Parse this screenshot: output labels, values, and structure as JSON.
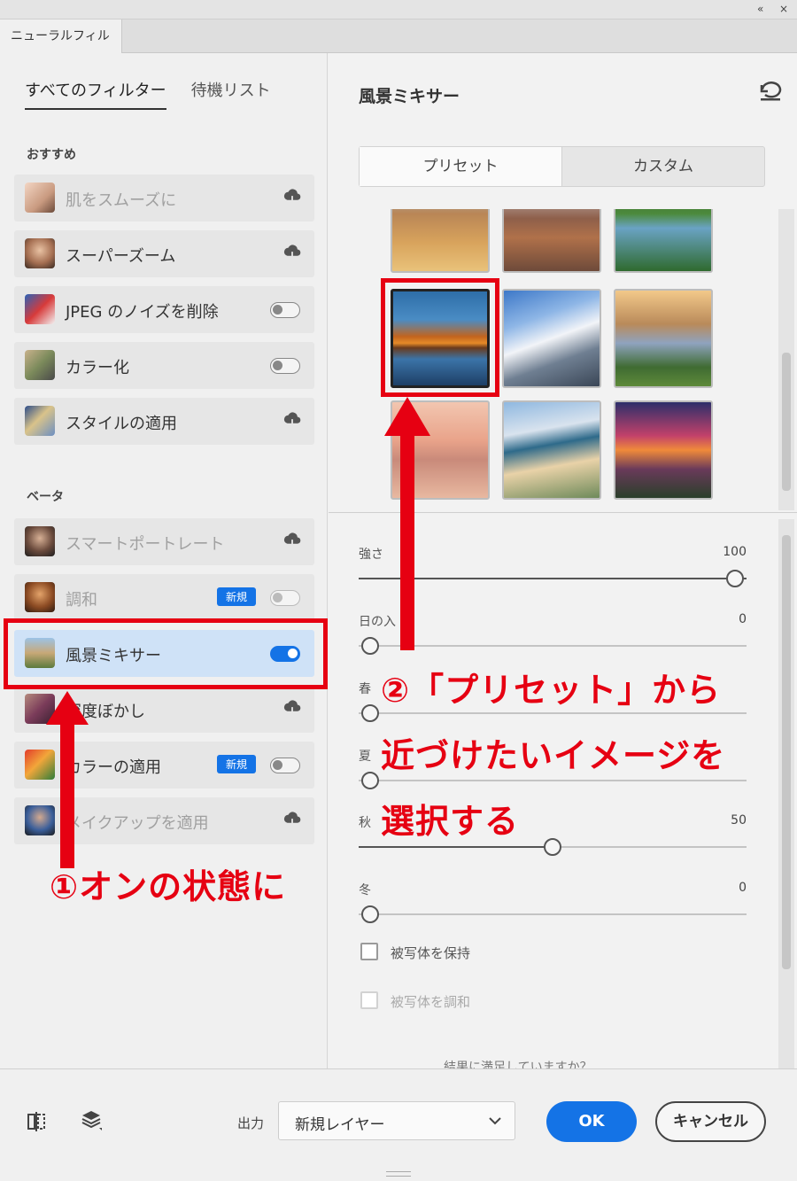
{
  "window": {
    "controls": [
      "«",
      "×"
    ],
    "panel_tab": "ニューラルフィルター"
  },
  "left": {
    "tabs": [
      {
        "label": "すべてのフィルター",
        "active": true
      },
      {
        "label": "待機リスト",
        "active": false
      }
    ],
    "sections": [
      {
        "title": "おすすめ",
        "items": [
          {
            "label": "肌をスムーズに",
            "control": "cloud-download",
            "dimmed": true
          },
          {
            "label": "スーパーズーム",
            "control": "cloud-download",
            "dimmed": false
          },
          {
            "label": "JPEG のノイズを削除",
            "control": "toggle-off",
            "dimmed": false
          },
          {
            "label": "カラー化",
            "control": "toggle-off",
            "dimmed": false
          },
          {
            "label": "スタイルの適用",
            "control": "cloud-download",
            "dimmed": false
          }
        ]
      },
      {
        "title": "ベータ",
        "items": [
          {
            "label": "スマートポートレート",
            "control": "cloud-download",
            "dimmed": true
          },
          {
            "label": "調和",
            "control": "toggle-off",
            "badge": "新規",
            "dimmed": true
          },
          {
            "label": "風景ミキサー",
            "control": "toggle-on",
            "dimmed": false,
            "selected": true
          },
          {
            "label": "深度ぼかし",
            "control": "cloud-download",
            "dimmed": false
          },
          {
            "label": "カラーの適用",
            "control": "toggle-off",
            "badge": "新規",
            "dimmed": false
          },
          {
            "label": "メイクアップを適用",
            "control": "cloud-download",
            "dimmed": true
          }
        ]
      }
    ]
  },
  "right": {
    "title": "風景ミキサー",
    "segments": [
      {
        "label": "プリセット",
        "active": true
      },
      {
        "label": "カスタム",
        "active": false
      }
    ],
    "presets_selected_index": 3,
    "sliders": [
      {
        "label": "強さ",
        "value": "100",
        "fraction": 1.0
      },
      {
        "label": "日の入",
        "value": "0",
        "fraction": 0.0
      },
      {
        "label": "春",
        "value": "",
        "fraction": 0.0
      },
      {
        "label": "夏",
        "value": "",
        "fraction": 0.0
      },
      {
        "label": "秋",
        "value": "50",
        "fraction": 0.5
      },
      {
        "label": "冬",
        "value": "0",
        "fraction": 0.0
      }
    ],
    "checkboxes": [
      {
        "label": "被写体を保持",
        "checked": false,
        "disabled": false
      },
      {
        "label": "被写体を調和",
        "checked": false,
        "disabled": true
      }
    ],
    "feedback_text": "結果に満足していますか？"
  },
  "footer": {
    "output_label": "出力",
    "output_value": "新規レイヤー",
    "ok_label": "OK",
    "cancel_label": "キャンセル"
  },
  "annotations": {
    "step1": "①オンの状態に",
    "step2_line1": "②「プリセット」から",
    "step2_line2": "近づけたいイメージを",
    "step2_line3": "選択する",
    "color": "#e60012"
  },
  "colors": {
    "accent": "#1473e6",
    "selected_row": "#cfe2f7",
    "annotation_red": "#e60012"
  }
}
